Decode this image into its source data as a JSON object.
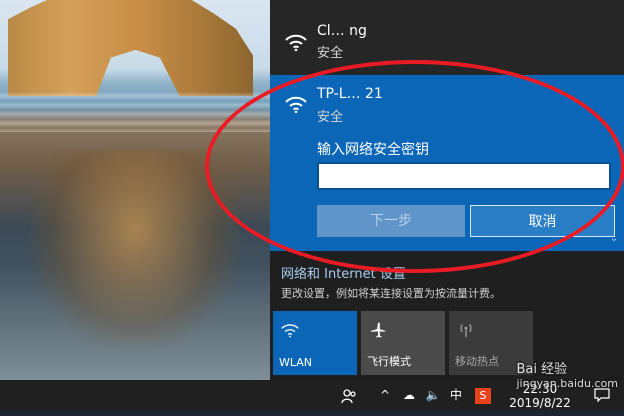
{
  "networks": [
    {
      "name": "Cl… ng",
      "status": "安全"
    },
    {
      "name": "TP-L… 21",
      "status": "安全"
    }
  ],
  "password_prompt": {
    "label": "输入网络安全密钥",
    "value": "",
    "next_label": "下一步",
    "cancel_label": "取消"
  },
  "settings": {
    "link_text": "网络和 Internet 设置",
    "description": "更改设置，例如将某连接设置为按流量计费。"
  },
  "quick_actions": [
    {
      "label": "WLAN",
      "icon": "wifi-icon",
      "active": true
    },
    {
      "label": "飞行模式",
      "icon": "airplane-icon",
      "active": false
    },
    {
      "label": "移动热点",
      "icon": "hotspot-icon",
      "active": false
    }
  ],
  "taskbar": {
    "ime": "中",
    "time": "22:30",
    "date": "2019/8/22",
    "icons": [
      "people-icon",
      "chevron-up-icon",
      "onedrive-icon",
      "sound-muted-icon",
      "ime-icon",
      "sogou-icon",
      "notification-icon"
    ]
  },
  "watermark": {
    "brand": "Bai 经验",
    "url": "jingyan.baidu.com"
  },
  "colors": {
    "accent": "#0b66b8",
    "annotation": "#ea1b24",
    "panel": "#1f1f1f"
  }
}
